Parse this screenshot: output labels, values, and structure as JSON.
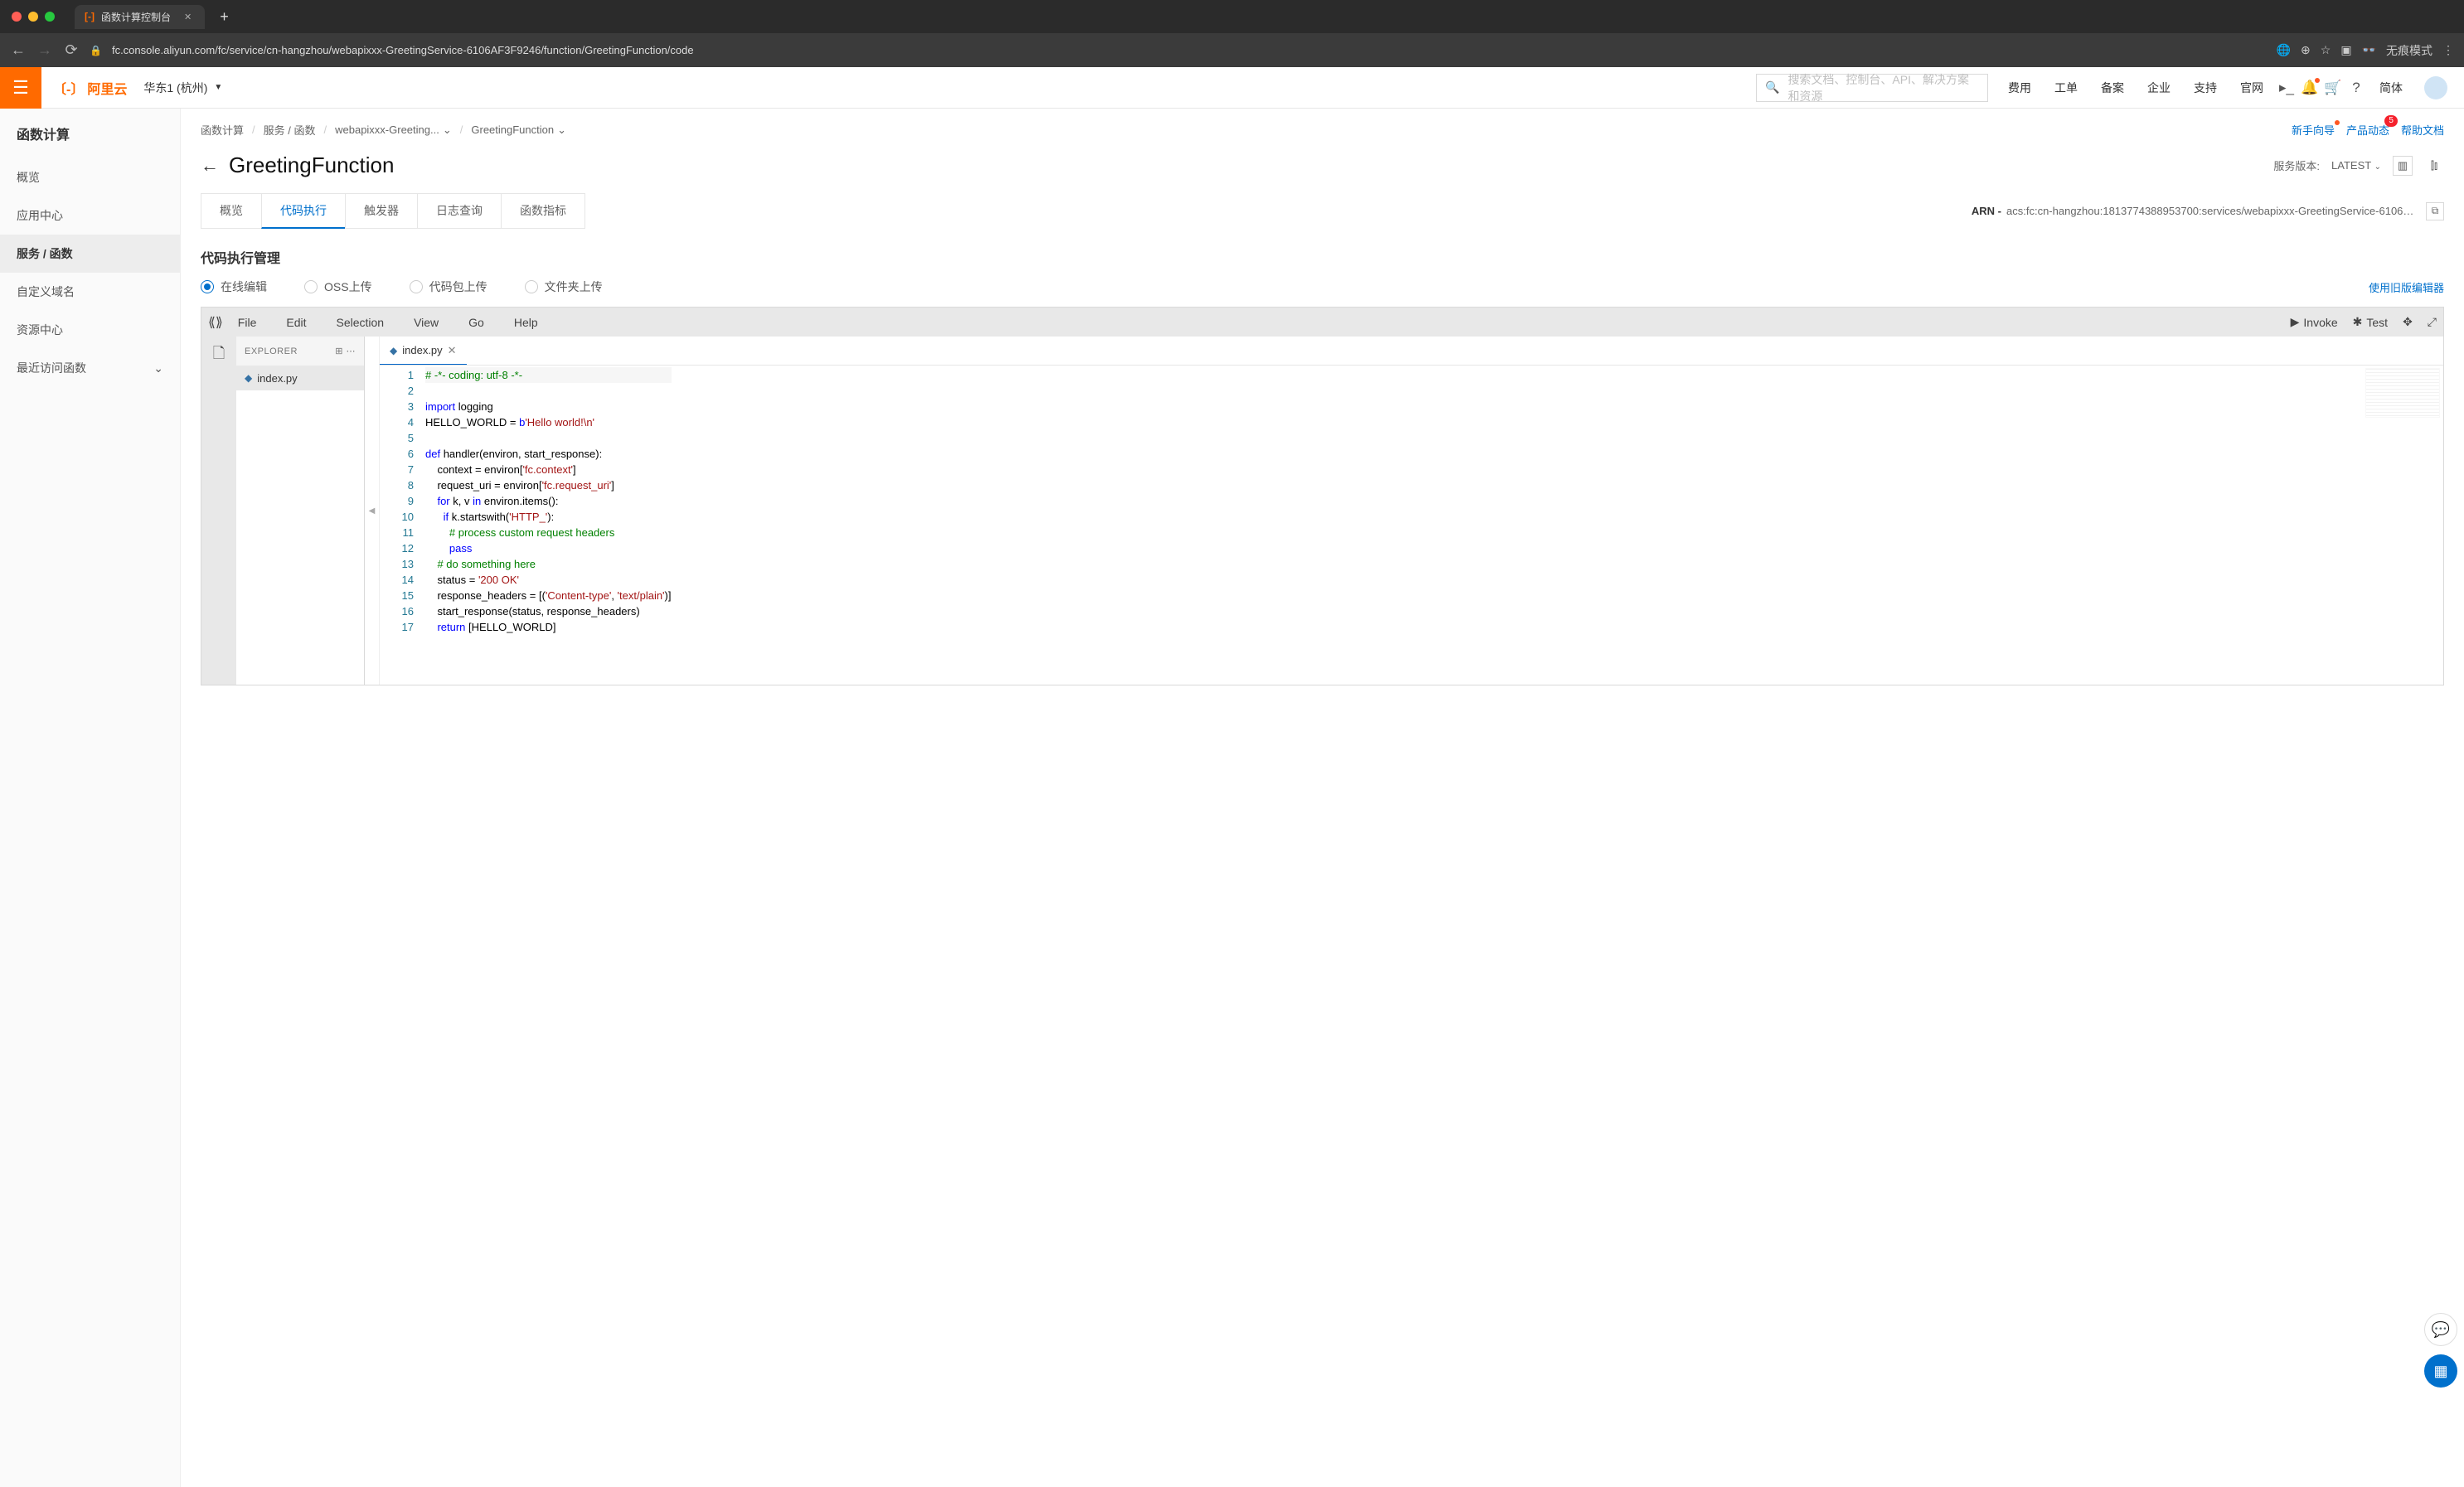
{
  "browser": {
    "tab_title": "函数计算控制台",
    "url": "fc.console.aliyun.com/fc/service/cn-hangzhou/webapixxx-GreetingService-6106AF3F9246/function/GreetingFunction/code",
    "mode": "无痕模式"
  },
  "header": {
    "logo": "阿里云",
    "region": "华东1 (杭州)",
    "search_placeholder": "搜索文档、控制台、API、解决方案和资源",
    "links": [
      "费用",
      "工单",
      "备案",
      "企业",
      "支持",
      "官网"
    ],
    "lang": "简体"
  },
  "sidebar": {
    "title": "函数计算",
    "items": [
      "概览",
      "应用中心",
      "服务 / 函数",
      "自定义域名",
      "资源中心",
      "最近访问函数"
    ],
    "active_index": 2
  },
  "crumbs": {
    "items": [
      "函数计算",
      "服务 / 函数",
      "webapixxx-Greeting...",
      "GreetingFunction"
    ]
  },
  "top_actions": {
    "a1": "新手向导",
    "a2": "产品动态",
    "a2_badge": "5",
    "a3": "帮助文档"
  },
  "page": {
    "title": "GreetingFunction",
    "version_label": "服务版本:",
    "version_value": "LATEST"
  },
  "tabs": {
    "items": [
      "概览",
      "代码执行",
      "触发器",
      "日志查询",
      "函数指标"
    ],
    "active_index": 1
  },
  "arn": {
    "label": "ARN - ",
    "value": "acs:fc:cn-hangzhou:1813774388953700:services/webapixxx-GreetingService-6106AF..."
  },
  "section_title": "代码执行管理",
  "radios": [
    "在线编辑",
    "OSS上传",
    "代码包上传",
    "文件夹上传"
  ],
  "legacy_link": "使用旧版编辑器",
  "ide": {
    "menu": [
      "File",
      "Edit",
      "Selection",
      "View",
      "Go",
      "Help"
    ],
    "invoke": "Invoke",
    "test": "Test",
    "explorer_title": "EXPLORER",
    "file": "index.py",
    "code_lines": [
      {
        "n": 1,
        "html": "<span class='tok-c'># -*- coding: utf-8 -*-</span>",
        "hl": true
      },
      {
        "n": 2,
        "html": ""
      },
      {
        "n": 3,
        "html": "<span class='tok-k'>import</span> <span class='tok-n'>logging</span>"
      },
      {
        "n": 4,
        "html": "<span class='tok-n'>HELLO_WORLD = </span><span class='tok-k'>b</span><span class='tok-s'>'Hello world!\\n'</span>"
      },
      {
        "n": 5,
        "html": ""
      },
      {
        "n": 6,
        "html": "<span class='tok-k'>def</span> <span class='tok-n'>handler(environ, start_response):</span>"
      },
      {
        "n": 7,
        "html": "    <span class='tok-n'>context = environ[</span><span class='tok-s'>'fc.context'</span><span class='tok-n'>]</span>"
      },
      {
        "n": 8,
        "html": "    <span class='tok-n'>request_uri = environ[</span><span class='tok-s'>'fc.request_uri'</span><span class='tok-n'>]</span>"
      },
      {
        "n": 9,
        "html": "    <span class='tok-k'>for</span> <span class='tok-n'>k, v</span> <span class='tok-k'>in</span> <span class='tok-n'>environ.items():</span>"
      },
      {
        "n": 10,
        "html": "      <span class='tok-k'>if</span> <span class='tok-n'>k.startswith(</span><span class='tok-s'>'HTTP_'</span><span class='tok-n'>):</span>"
      },
      {
        "n": 11,
        "html": "        <span class='tok-c'># process custom request headers</span>"
      },
      {
        "n": 12,
        "html": "        <span class='tok-k'>pass</span>"
      },
      {
        "n": 13,
        "html": "    <span class='tok-c'># do something here</span>"
      },
      {
        "n": 14,
        "html": "    <span class='tok-n'>status = </span><span class='tok-s'>'200 OK'</span>"
      },
      {
        "n": 15,
        "html": "    <span class='tok-n'>response_headers = [(</span><span class='tok-s'>'Content-type'</span><span class='tok-n'>, </span><span class='tok-s'>'text/plain'</span><span class='tok-n'>)]</span>"
      },
      {
        "n": 16,
        "html": "    <span class='tok-n'>start_response(status, response_headers)</span>"
      },
      {
        "n": 17,
        "html": "    <span class='tok-k'>return</span> <span class='tok-n'>[HELLO_WORLD]</span>"
      }
    ]
  }
}
